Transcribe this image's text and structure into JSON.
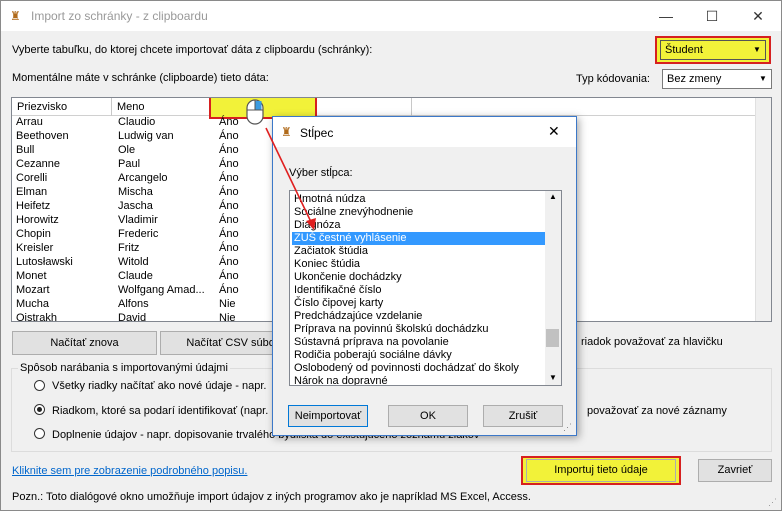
{
  "window": {
    "title": "Import zo schránky - z clipboardu",
    "minimize": "—",
    "maximize": "☐",
    "close": "✕"
  },
  "prompt_table": "Vyberte tabuľku, do ktorej chcete importovať dáta z clipboardu (schránky):",
  "table_select": {
    "value": "Študent"
  },
  "clipboard_label": "Momentálne máte v schránke (clipboarde) tieto dáta:",
  "encoding": {
    "label": "Typ kódovania:",
    "value": "Bez zmeny"
  },
  "grid": {
    "headers": [
      "Priezvisko",
      "Meno",
      ""
    ],
    "rows": [
      [
        "Arrau",
        "Claudio",
        "Áno"
      ],
      [
        "Beethoven",
        "Ludwig van",
        "Áno"
      ],
      [
        "Bull",
        "Ole",
        "Áno"
      ],
      [
        "Cezanne",
        "Paul",
        "Áno"
      ],
      [
        "Corelli",
        "Arcangelo",
        "Áno"
      ],
      [
        "Elman",
        "Mischa",
        "Áno"
      ],
      [
        "Heifetz",
        "Jascha",
        "Áno"
      ],
      [
        "Horowitz",
        "Vladimir",
        "Áno"
      ],
      [
        "Chopin",
        "Frederic",
        "Áno"
      ],
      [
        "Kreisler",
        "Fritz",
        "Áno"
      ],
      [
        "Lutosławski",
        "Witold",
        "Áno"
      ],
      [
        "Monet",
        "Claude",
        "Áno"
      ],
      [
        "Mozart",
        "Wolfgang Amad...",
        "Áno"
      ],
      [
        "Mucha",
        "Alfons",
        "Nie"
      ],
      [
        "Oistrakh",
        "David",
        "Nie"
      ]
    ]
  },
  "buttons": {
    "reload": "Načítať znova",
    "load_csv": "Načítať CSV súbor",
    "import": "Importuj tieto údaje",
    "close": "Zavrieť"
  },
  "header_checkbox": "riadok považovať za hlavičku",
  "group": {
    "title": "Spôsob narábania s importovanými údajmi",
    "opt1": "Všetky riadky načítať ako nové údaje - napr.",
    "opt2": "Riadkom, ktoré sa podarí identifikovať (napr.",
    "opt2_tail": "považovať za nové záznamy",
    "opt3": "Doplnenie údajov - napr. dopisovanie trvalého bydliska do existujúceho zoznamu žiakov"
  },
  "detail_link": "Kliknite sem pre zobrazenie podrobného popisu.",
  "note": "Pozn.: Toto dialógové okno umožňuje import údajov z iných programov ako je napríklad MS Excel, Access.",
  "dialog": {
    "title": "Stĺpec",
    "label": "Výber stĺpca:",
    "items": [
      "Hmotná núdza",
      "Sociálne znevýhodnenie",
      "Diagnóza",
      "ZUŠ čestné vyhlásenie",
      "Začiatok štúdia",
      "Koniec štúdia",
      "Ukončenie dochádzky",
      "Identifikačné číslo",
      "Číslo čipovej karty",
      "Predchádzajúce vzdelanie",
      "Príprava na povinnú školskú dochádzku",
      "Sústavná príprava na povolanie",
      "Rodičia poberajú sociálne dávky",
      "Oslobodený od povinnosti dochádzať do školy",
      "Nárok na dopravné"
    ],
    "selected_index": 3,
    "btn_skip": "Neimportovať",
    "btn_ok": "OK",
    "btn_cancel": "Zrušiť",
    "close": "✕"
  },
  "colors": {
    "highlight": "#f2f239",
    "highlight_border": "#d62020",
    "selection": "#3399ff",
    "link": "#0066cc"
  }
}
